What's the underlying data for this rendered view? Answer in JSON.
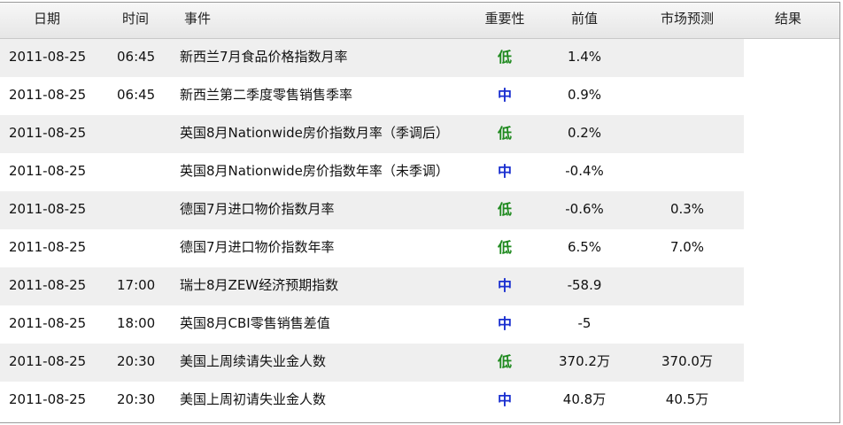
{
  "headers": {
    "date": "日期",
    "time": "时间",
    "event": "事件",
    "importance": "重要性",
    "previous": "前值",
    "forecast": "市场预测",
    "result": "结果"
  },
  "colors": {
    "low": "#1f8a1f",
    "mid": "#1a2fd0",
    "row_shade": "#efefef"
  },
  "rows": [
    {
      "date": "2011-08-25",
      "time": "06:45",
      "event": "新西兰7月食品价格指数月率",
      "importance": "低",
      "level": "low",
      "previous": "1.4%",
      "forecast": "",
      "result": ""
    },
    {
      "date": "2011-08-25",
      "time": "06:45",
      "event": "新西兰第二季度零售销售季率",
      "importance": "中",
      "level": "mid",
      "previous": "0.9%",
      "forecast": "",
      "result": ""
    },
    {
      "date": "2011-08-25",
      "time": "",
      "event": "英国8月Nationwide房价指数月率（季调后）",
      "importance": "低",
      "level": "low",
      "previous": "0.2%",
      "forecast": "",
      "result": ""
    },
    {
      "date": "2011-08-25",
      "time": "",
      "event": "英国8月Nationwide房价指数年率（未季调）",
      "importance": "中",
      "level": "mid",
      "previous": "-0.4%",
      "forecast": "",
      "result": ""
    },
    {
      "date": "2011-08-25",
      "time": "",
      "event": "德国7月进口物价指数月率",
      "importance": "低",
      "level": "low",
      "previous": "-0.6%",
      "forecast": "0.3%",
      "result": ""
    },
    {
      "date": "2011-08-25",
      "time": "",
      "event": "德国7月进口物价指数年率",
      "importance": "低",
      "level": "low",
      "previous": "6.5%",
      "forecast": "7.0%",
      "result": ""
    },
    {
      "date": "2011-08-25",
      "time": "17:00",
      "event": "瑞士8月ZEW经济预期指数",
      "importance": "中",
      "level": "mid",
      "previous": "-58.9",
      "forecast": "",
      "result": ""
    },
    {
      "date": "2011-08-25",
      "time": "18:00",
      "event": "英国8月CBI零售销售差值",
      "importance": "中",
      "level": "mid",
      "previous": "-5",
      "forecast": "",
      "result": ""
    },
    {
      "date": "2011-08-25",
      "time": "20:30",
      "event": "美国上周续请失业金人数",
      "importance": "低",
      "level": "low",
      "previous": "370.2万",
      "forecast": "370.0万",
      "result": ""
    },
    {
      "date": "2011-08-25",
      "time": "20:30",
      "event": "美国上周初请失业金人数",
      "importance": "中",
      "level": "mid",
      "previous": "40.8万",
      "forecast": "40.5万",
      "result": ""
    }
  ]
}
